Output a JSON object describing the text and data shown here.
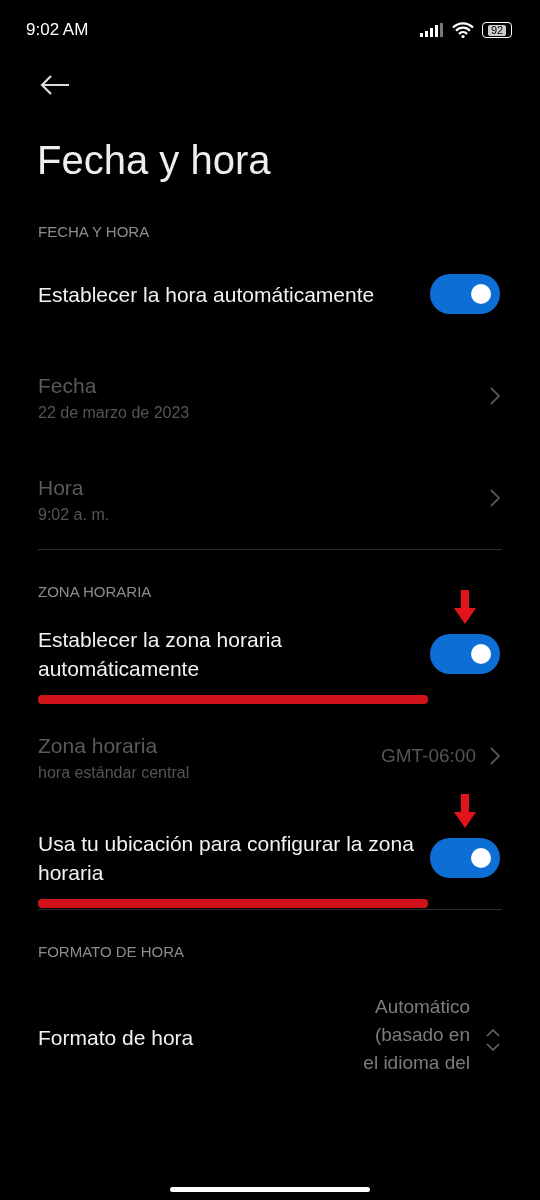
{
  "status_bar": {
    "time": "9:02 AM",
    "battery": "92"
  },
  "title": "Fecha y hora",
  "sections": [
    {
      "header": "FECHA Y HORA",
      "items": [
        {
          "kind": "toggle",
          "title": "Establecer la hora automáticamente",
          "on": true,
          "disabled": false,
          "marked": false
        },
        {
          "kind": "nav",
          "title": "Fecha",
          "subtitle": "22 de marzo de 2023",
          "disabled": true
        },
        {
          "kind": "nav",
          "title": "Hora",
          "subtitle": "9:02 a. m.",
          "disabled": true
        }
      ]
    },
    {
      "header": "ZONA HORARIA",
      "items": [
        {
          "kind": "toggle",
          "title": "Establecer la zona horaria automáticamente",
          "on": true,
          "disabled": false,
          "marked": true
        },
        {
          "kind": "nav",
          "title": "Zona horaria",
          "subtitle": "hora estándar central",
          "value": "GMT-06:00",
          "disabled": true
        },
        {
          "kind": "toggle",
          "title": "Usa tu ubicación para configurar la zona horaria",
          "on": true,
          "disabled": false,
          "marked": true
        }
      ]
    },
    {
      "header": "FORMATO DE HORA",
      "items": [
        {
          "kind": "dropdown",
          "title": "Formato de hora",
          "value": "Automático (basado en el idioma del",
          "disabled": false
        }
      ]
    }
  ]
}
